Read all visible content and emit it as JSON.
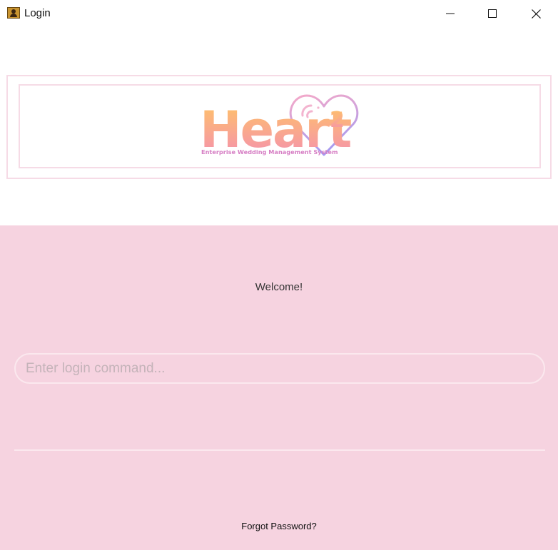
{
  "window": {
    "title": "Login",
    "icon": "user-card-icon",
    "controls": [
      "minimize-icon",
      "maximize-icon",
      "close-icon"
    ]
  },
  "logo": {
    "name": "Heart",
    "superscript": "2",
    "tagline": "Enterprise Wedding Management System"
  },
  "main": {
    "welcome": "Welcome!",
    "command_placeholder": "Enter login command...",
    "command_value": "",
    "forgot_password": "Forgot Password?"
  },
  "colors": {
    "panel_background": "#f6d3e0",
    "border_light": "#fbe8ee",
    "logo_gradient_top": "#ffc466",
    "logo_gradient_bottom": "#f48fb1",
    "heart_stroke_top": "#f5a9c8",
    "heart_stroke_bottom": "#a79af0",
    "tagline": "#d67ec4"
  }
}
